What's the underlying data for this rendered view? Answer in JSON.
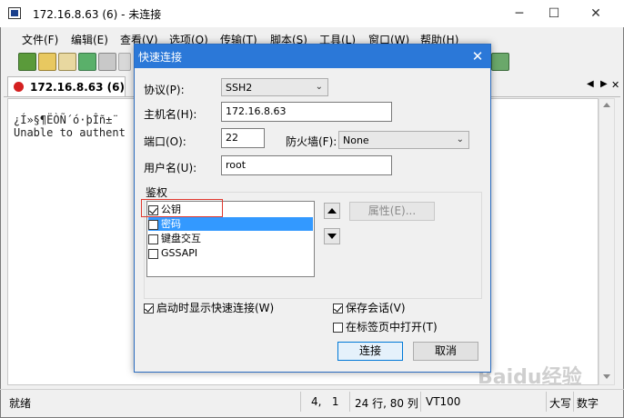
{
  "window": {
    "title": "172.16.8.63 (6) - 未连接",
    "controls": {
      "minimize": "─",
      "maximize": "☐",
      "close": "✕"
    }
  },
  "menu": [
    "文件(F)",
    "编辑(E)",
    "查看(V)",
    "选项(O)",
    "传输(T)",
    "脚本(S)",
    "工具(L)",
    "窗口(W)",
    "帮助(H)"
  ],
  "tabs": {
    "active_label": "172.16.8.63 (6)",
    "nav_left": "◀",
    "nav_right": "▶",
    "close": "✕"
  },
  "terminal": {
    "lines": [
      "¿Í»§¶ËÒÑ´ó·þÎñ±¨",
      "Unable to authent"
    ]
  },
  "statusbar": {
    "status": "就绪",
    "cursor": "4,   1",
    "size": "24 行, 80 列",
    "emulation": "VT100",
    "caps": "大写",
    "num": "数字"
  },
  "dialog": {
    "title": "快速连接",
    "close": "✕",
    "protocol_label": "协议(P):",
    "protocol_value": "SSH2",
    "hostname_label": "主机名(H):",
    "hostname_value": "172.16.8.63",
    "port_label": "端口(O):",
    "port_value": "22",
    "firewall_label": "防火墙(F):",
    "firewall_value": "None",
    "username_label": "用户名(U):",
    "username_value": "root",
    "auth_group": "鉴权",
    "auth_methods": [
      {
        "label": "公钥",
        "checked": true,
        "selected": false
      },
      {
        "label": "密码",
        "checked": false,
        "selected": true
      },
      {
        "label": "键盘交互",
        "checked": false,
        "selected": false
      },
      {
        "label": "GSSAPI",
        "checked": false,
        "selected": false
      }
    ],
    "properties_button": "属性(E)...",
    "show_on_startup": "启动时显示快速连接(W)",
    "save_session": "保存会话(V)",
    "open_in_tab": "在标签页中打开(T)",
    "connect_button": "连接",
    "cancel_button": "取消"
  },
  "watermark": "Baidu经验"
}
